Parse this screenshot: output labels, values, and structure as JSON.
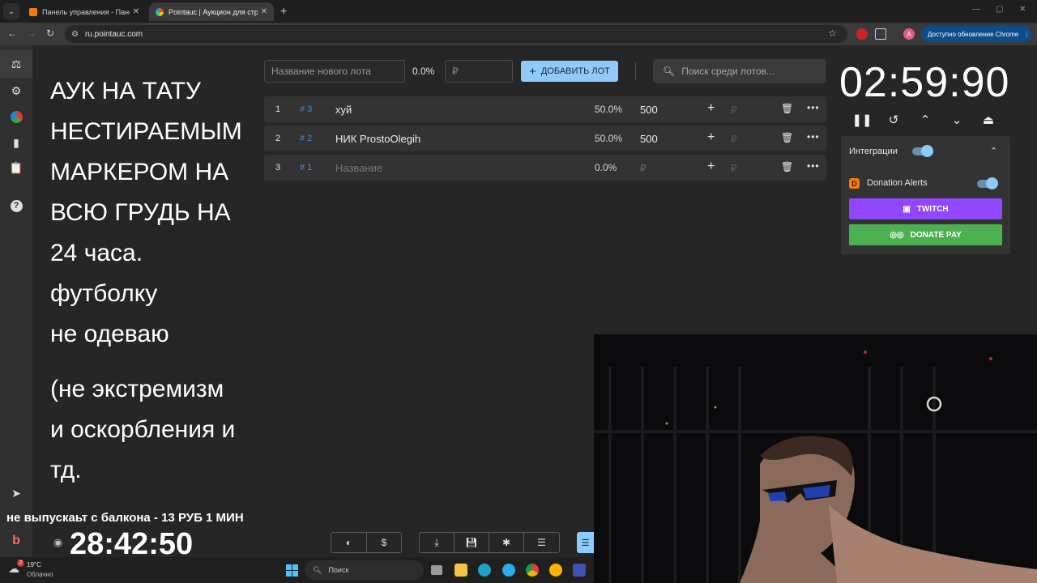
{
  "browser": {
    "tabs": [
      {
        "title": "Панель управления - Панель"
      },
      {
        "title": "Pointauc | Аукцион для стрим"
      }
    ],
    "url": "ru.pointauc.com",
    "update_label": "Доступно обновление Chrome"
  },
  "rules_text": {
    "line1": "АУК НА ТАТУ",
    "line2": "НЕСТИРАЕМЫМ",
    "line3": "МАРКЕРОМ НА",
    "line4": "ВСЮ ГРУДЬ НА",
    "line5": "24 часа.",
    "line6": "футболку",
    "line7": "не одеваю",
    "line8": "(не экстремизм",
    "line9": "и оскорбления и",
    "line10": "тд."
  },
  "lot_form": {
    "name_placeholder": "Название нового лота",
    "percent": "0.0%",
    "amount_placeholder": "₽",
    "add_button": "ДОБАВИТЬ ЛОТ",
    "search_placeholder": "Поиск среди лотов..."
  },
  "lots": [
    {
      "num": "1",
      "id": "# 3",
      "name": "хуй",
      "percent": "50.0%",
      "amount": "500",
      "currency": "₽"
    },
    {
      "num": "2",
      "id": "# 2",
      "name": "НИК ProstoOlegih",
      "percent": "50.0%",
      "amount": "500",
      "currency": "₽"
    },
    {
      "num": "3",
      "id": "# 1",
      "name_placeholder": "Название",
      "percent": "0.0%",
      "amount_placeholder": "₽",
      "currency": "₽"
    }
  ],
  "timer": {
    "value": "02:59:90"
  },
  "integrations": {
    "title": "Интеграции",
    "enabled": true,
    "donation_alerts": {
      "label": "Donation Alerts",
      "enabled": true
    },
    "twitch_label": "TWITCH",
    "donatepay_label": "DONATE PAY"
  },
  "overlay": {
    "marquee": "не выпускаьт с балкона - 13 РУБ 1 МИН",
    "big_timer": "28:42:50"
  },
  "taskbar": {
    "temperature": "19°C",
    "weather": "Облачно",
    "search_label": "Поиск",
    "weather_badge": "2"
  },
  "colors": {
    "accent": "#90caf9",
    "twitch": "#9146ff",
    "donatepay": "#4caf50",
    "donation_alerts": "#f57d07",
    "chrome_update": "#0f4c8a"
  }
}
